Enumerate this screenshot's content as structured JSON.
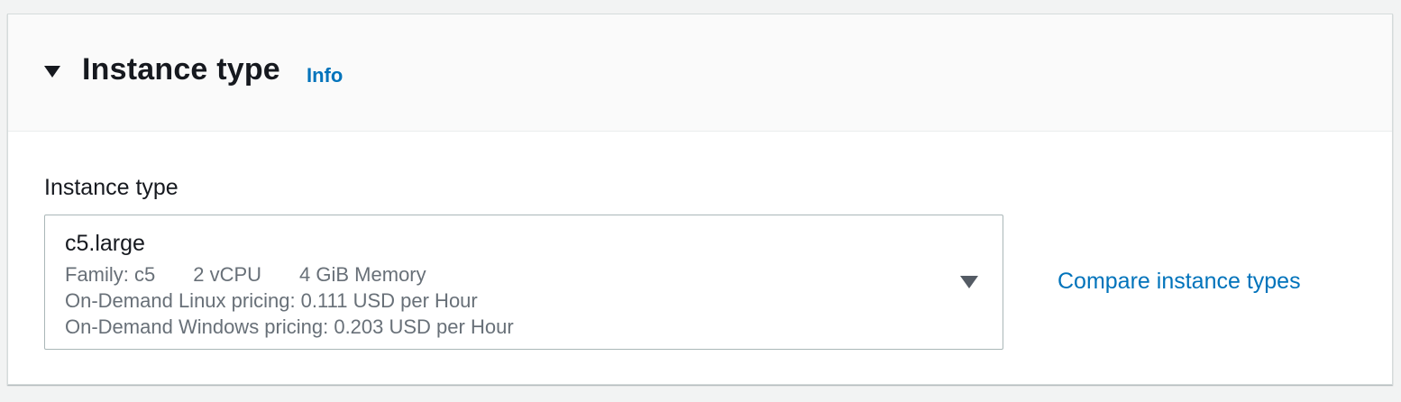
{
  "section": {
    "title": "Instance type",
    "info_label": "Info",
    "toggle_icon": "caret-down-icon"
  },
  "field": {
    "label": "Instance type",
    "selected": {
      "name": "c5.large",
      "tags": [
        "Family: c5",
        "2 vCPU",
        "4 GiB Memory"
      ],
      "linux_pricing": "On-Demand Linux pricing: 0.111 USD per Hour",
      "windows_pricing": "On-Demand Windows pricing: 0.203 USD per Hour"
    },
    "dropdown_icon": "caret-down-icon"
  },
  "compare_link": "Compare instance types",
  "colors": {
    "link": "#0073bb",
    "text": "#16191f",
    "secondary_text": "#687078",
    "border": "#aab7b8",
    "background": "#f2f3f3"
  }
}
